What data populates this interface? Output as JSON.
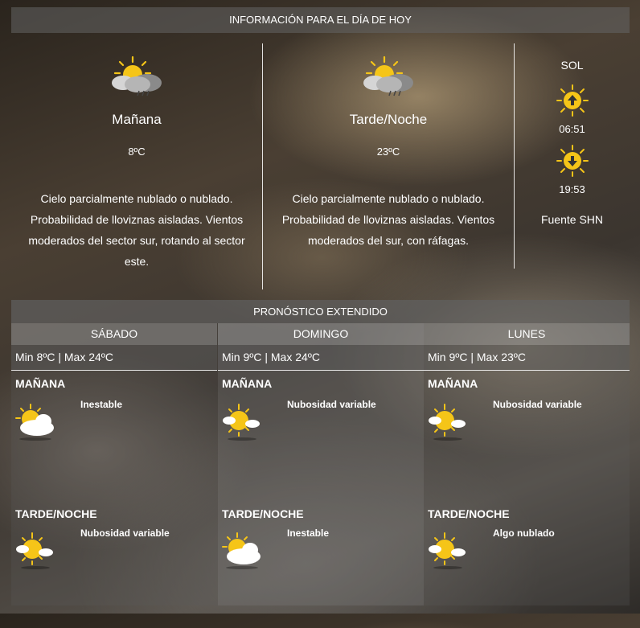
{
  "today": {
    "header": "INFORMACIÓN PARA EL DÍA DE HOY",
    "morning": {
      "title": "Mañana",
      "temp": "8ºC",
      "description": "Cielo parcialmente nublado o nublado. Probabilidad de lloviznas aisladas. Vientos moderados del sector sur, rotando al sector este.",
      "icon": "sun-cloud-rain-icon"
    },
    "afternoon": {
      "title": "Tarde/Noche",
      "temp": "23ºC",
      "description": "Cielo parcialmente nublado o nublado. Probabilidad de lloviznas aisladas. Vientos moderados del sur, con ráfagas.",
      "icon": "sun-cloud-rain-icon"
    },
    "sun": {
      "title": "SOL",
      "sunrise": "06:51",
      "sunset": "19:53",
      "source": "Fuente SHN"
    }
  },
  "extended": {
    "header": "PRONÓSTICO EXTENDIDO",
    "days": [
      {
        "name": "SÁBADO",
        "minmax": "Min 8ºC | Max 24ºC",
        "morning": {
          "label": "MAÑANA",
          "desc": "Inestable",
          "icon": "sun-cloud-icon"
        },
        "afternoon": {
          "label": "TARDE/NOCHE",
          "desc": "Nubosidad variable",
          "icon": "sun-small-cloud-icon"
        }
      },
      {
        "name": "DOMINGO",
        "minmax": "Min 9ºC | Max 24ºC",
        "morning": {
          "label": "MAÑANA",
          "desc": "Nubosidad variable",
          "icon": "sun-small-cloud-icon"
        },
        "afternoon": {
          "label": "TARDE/NOCHE",
          "desc": "Inestable",
          "icon": "sun-cloud-icon"
        }
      },
      {
        "name": "LUNES",
        "minmax": "Min 9ºC | Max 23ºC",
        "morning": {
          "label": "MAÑANA",
          "desc": "Nubosidad variable",
          "icon": "sun-small-cloud-icon"
        },
        "afternoon": {
          "label": "TARDE/NOCHE",
          "desc": "Algo nublado",
          "icon": "sun-small-cloud-icon"
        }
      }
    ]
  },
  "colors": {
    "sun": "#f5c518",
    "cloud": "#ffffff",
    "panel": "#646464"
  }
}
